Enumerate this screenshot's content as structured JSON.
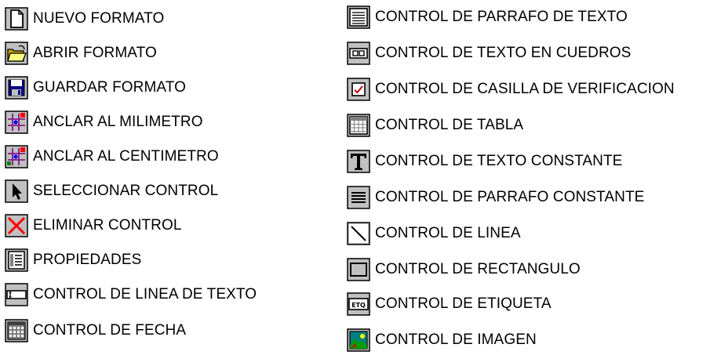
{
  "left_items": [
    {
      "label": "NUEVO FORMATO",
      "icon": "new-document-icon"
    },
    {
      "label": "ABRIR FORMATO",
      "icon": "open-folder-icon"
    },
    {
      "label": "GUARDAR FORMATO",
      "icon": "save-floppy-icon"
    },
    {
      "label": "ANCLAR AL MILIMETRO",
      "icon": "anchor-grid-mm-icon"
    },
    {
      "label": "ANCLAR AL CENTIMETRO",
      "icon": "anchor-grid-cm-icon"
    },
    {
      "label": "SELECCIONAR CONTROL",
      "icon": "pointer-arrow-icon"
    },
    {
      "label": "ELIMINAR CONTROL",
      "icon": "delete-x-icon"
    },
    {
      "label": "PROPIEDADES",
      "icon": "properties-icon"
    },
    {
      "label": "CONTROL DE LINEA DE TEXTO",
      "icon": "text-line-icon"
    },
    {
      "label": "CONTROL DE FECHA",
      "icon": "calendar-icon"
    }
  ],
  "right_items": [
    {
      "label": "CONTROL DE PARRAFO DE TEXTO",
      "icon": "text-paragraph-icon"
    },
    {
      "label": "CONTROL DE TEXTO EN CUEDROS",
      "icon": "boxed-text-icon"
    },
    {
      "label": "CONTROL DE CASILLA DE VERIFICACION",
      "icon": "checkbox-icon"
    },
    {
      "label": "CONTROL DE TABLA",
      "icon": "table-icon"
    },
    {
      "label": "CONTROL DE TEXTO CONSTANTE",
      "icon": "constant-text-t-icon"
    },
    {
      "label": "CONTROL DE PARRAFO CONSTANTE",
      "icon": "constant-paragraph-icon"
    },
    {
      "label": "CONTROL DE LINEA",
      "icon": "line-icon"
    },
    {
      "label": "CONTROL DE RECTANGULO",
      "icon": "rectangle-icon"
    },
    {
      "label": "CONTROL DE ETIQUETA",
      "icon": "label-etq-icon"
    },
    {
      "label": "CONTROL DE IMAGEN",
      "icon": "image-icon"
    }
  ],
  "icon_text": {
    "etq": "ETQ"
  },
  "colors": {
    "text": "#000000",
    "background": "#ffffff",
    "icon_border": "#000000",
    "icon_face": "#c0c0c0",
    "folder_yellow": "#ffff80",
    "save_blue": "#000080",
    "delete_red": "#ff0000",
    "grid_purple": "#800080",
    "grid_blue": "#0000ff",
    "image_teal": "#008080",
    "image_green": "#00a000"
  }
}
